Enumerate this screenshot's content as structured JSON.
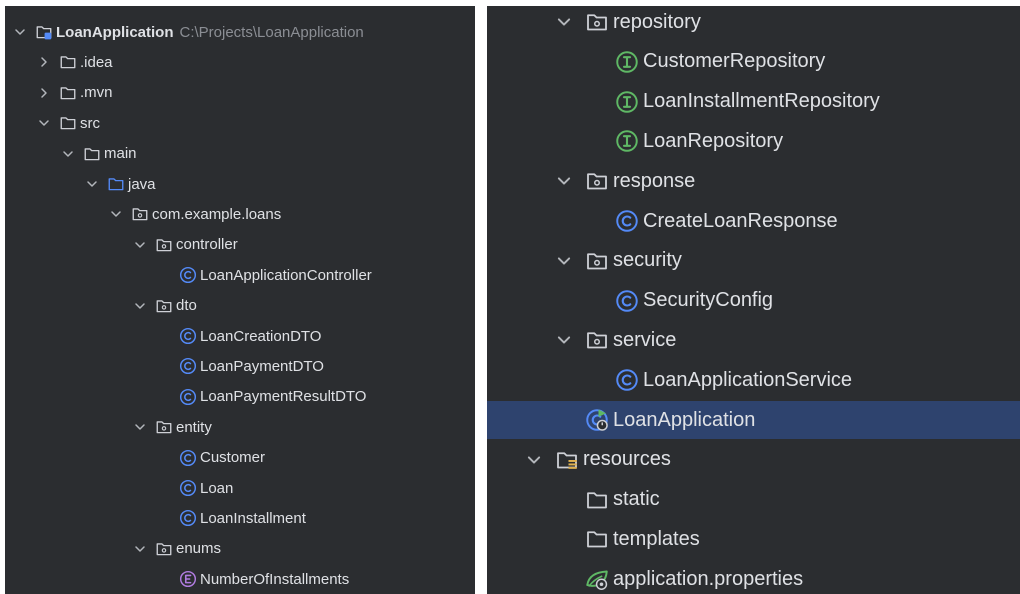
{
  "colors": {
    "panel_bg": "#2b2d30",
    "text": "#dfe1e5",
    "muted": "#8b8e94",
    "selection": "#2e436e",
    "class_icon": "#548af7",
    "interface_icon": "#5fb865",
    "enum_icon": "#b07ce0",
    "folder_blue": "#548af7"
  },
  "left_tree": [
    {
      "label": "LoanApplication",
      "secondary": "C:\\Projects\\LoanApplication",
      "icon": "module-folder-icon",
      "chevron": "down",
      "level": 0,
      "bold": true
    },
    {
      "label": ".idea",
      "icon": "folder-icon",
      "chevron": "right",
      "level": 1
    },
    {
      "label": ".mvn",
      "icon": "folder-icon",
      "chevron": "right",
      "level": 1
    },
    {
      "label": "src",
      "icon": "folder-icon",
      "chevron": "down",
      "level": 1
    },
    {
      "label": "main",
      "icon": "folder-icon",
      "chevron": "down",
      "level": 2
    },
    {
      "label": "java",
      "icon": "source-folder-icon",
      "chevron": "down",
      "level": 3
    },
    {
      "label": "com.example.loans",
      "icon": "package-icon",
      "chevron": "down",
      "level": 4
    },
    {
      "label": "controller",
      "icon": "package-icon",
      "chevron": "down",
      "level": 5
    },
    {
      "label": "LoanApplicationController",
      "icon": "class-icon",
      "chevron": "none",
      "level": 6
    },
    {
      "label": "dto",
      "icon": "package-icon",
      "chevron": "down",
      "level": 5
    },
    {
      "label": "LoanCreationDTO",
      "icon": "class-icon",
      "chevron": "none",
      "level": 6
    },
    {
      "label": "LoanPaymentDTO",
      "icon": "class-icon",
      "chevron": "none",
      "level": 6
    },
    {
      "label": "LoanPaymentResultDTO",
      "icon": "class-icon",
      "chevron": "none",
      "level": 6
    },
    {
      "label": "entity",
      "icon": "package-icon",
      "chevron": "down",
      "level": 5
    },
    {
      "label": "Customer",
      "icon": "class-icon",
      "chevron": "none",
      "level": 6
    },
    {
      "label": "Loan",
      "icon": "class-icon",
      "chevron": "none",
      "level": 6
    },
    {
      "label": "LoanInstallment",
      "icon": "class-icon",
      "chevron": "none",
      "level": 6
    },
    {
      "label": "enums",
      "icon": "package-icon",
      "chevron": "down",
      "level": 5
    },
    {
      "label": "NumberOfInstallments",
      "icon": "enum-icon",
      "chevron": "none",
      "level": 6
    }
  ],
  "right_tree": [
    {
      "label": "repository",
      "icon": "package-icon",
      "chevron": "down",
      "level": 2
    },
    {
      "label": "CustomerRepository",
      "icon": "interface-icon",
      "chevron": "none",
      "level": 3
    },
    {
      "label": "LoanInstallmentRepository",
      "icon": "interface-icon",
      "chevron": "none",
      "level": 3
    },
    {
      "label": "LoanRepository",
      "icon": "interface-icon",
      "chevron": "none",
      "level": 3
    },
    {
      "label": "response",
      "icon": "package-icon",
      "chevron": "down",
      "level": 2
    },
    {
      "label": "CreateLoanResponse",
      "icon": "class-icon",
      "chevron": "none",
      "level": 3
    },
    {
      "label": "security",
      "icon": "package-icon",
      "chevron": "down",
      "level": 2
    },
    {
      "label": "SecurityConfig",
      "icon": "class-icon",
      "chevron": "none",
      "level": 3
    },
    {
      "label": "service",
      "icon": "package-icon",
      "chevron": "down",
      "level": 2
    },
    {
      "label": "LoanApplicationService",
      "icon": "class-icon",
      "chevron": "none",
      "level": 3
    },
    {
      "label": "LoanApplication",
      "icon": "spring-boot-class-icon",
      "chevron": "none",
      "level": 2,
      "selected": true
    },
    {
      "label": "resources",
      "icon": "resources-folder-icon",
      "chevron": "down",
      "level": 1
    },
    {
      "label": "static",
      "icon": "folder-icon",
      "chevron": "none",
      "level": 2
    },
    {
      "label": "templates",
      "icon": "folder-icon",
      "chevron": "none",
      "level": 2
    },
    {
      "label": "application.properties",
      "icon": "spring-properties-icon",
      "chevron": "none",
      "level": 2
    }
  ]
}
